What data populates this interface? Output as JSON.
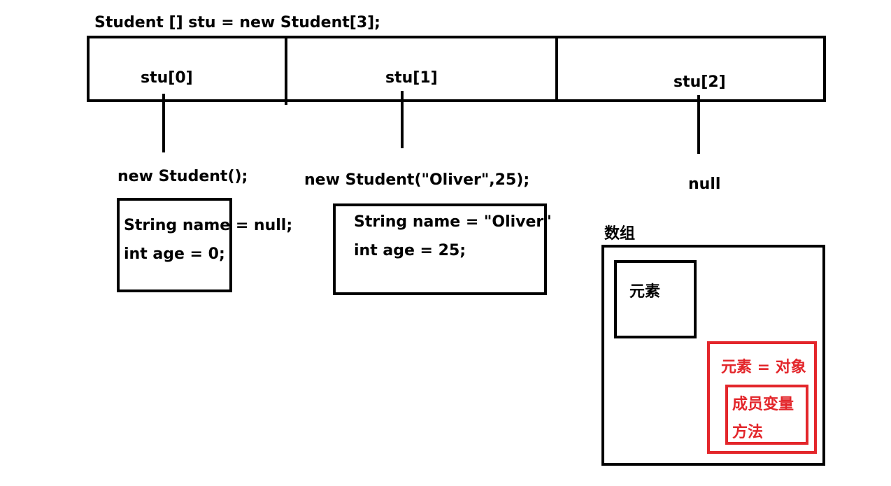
{
  "declaration": "Student [] stu = new Student[3];",
  "array_cells": [
    "stu[0]",
    "stu[1]",
    "stu[2]"
  ],
  "elements": [
    {
      "constructor": "new Student();",
      "fields": [
        "String name = null;",
        "int age = 0;"
      ]
    },
    {
      "constructor": "new Student(\"Oliver\",25);",
      "fields": [
        "String name = \"Oliver\"",
        "int age = 25;"
      ]
    },
    {
      "value": "null"
    }
  ],
  "legend": {
    "title": "数组",
    "element_label": "元素",
    "element_equals_object": "元素 = 对象",
    "member_variables": "成员变量",
    "methods": "方法"
  },
  "colors": {
    "line": "#000000",
    "highlight": "#e3262b"
  }
}
